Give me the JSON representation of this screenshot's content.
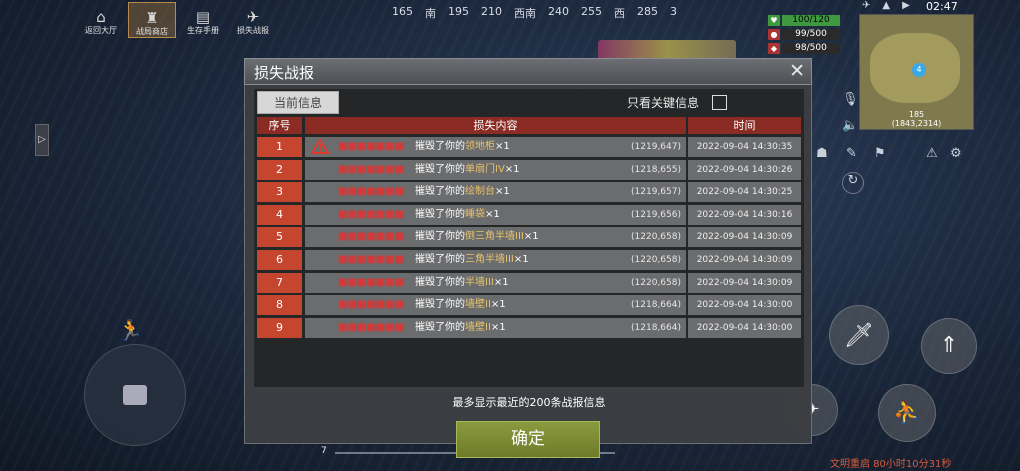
{
  "top_menu": [
    {
      "label": "返回大厅",
      "icon": "home-icon",
      "glyph": "⌂"
    },
    {
      "label": "战局商店",
      "icon": "shop-basket-icon",
      "glyph": "♜"
    },
    {
      "label": "生存手册",
      "icon": "book-icon",
      "glyph": "▤"
    },
    {
      "label": "损失战报",
      "icon": "broken-building-icon",
      "glyph": "✈"
    }
  ],
  "compass": [
    "165",
    "南",
    "195",
    "210",
    "西南",
    "240",
    "255",
    "西",
    "285",
    "3"
  ],
  "stats": [
    {
      "icon": "health-icon",
      "glyph": "♥",
      "value": "100/120",
      "color": "#3f9a3f"
    },
    {
      "icon": "food-icon",
      "glyph": "●",
      "value": "99/500",
      "color": "#a33"
    },
    {
      "icon": "water-icon",
      "glyph": "◆",
      "value": "98/500",
      "color": "#a33"
    }
  ],
  "clock": "02:47",
  "minimap": {
    "marker": "4",
    "coord_line1": "185",
    "coord_line2": "(1843,2314)"
  },
  "dialog": {
    "title": "损失战报",
    "close_glyph": "✕",
    "tab_current": "当前信息",
    "key_only_label": "只看关键信息",
    "key_only_checked": false,
    "columns": {
      "num": "序号",
      "content": "损失内容",
      "time": "时间"
    },
    "verb": "摧毁了你的",
    "rows": [
      {
        "num": "1",
        "player": "■■■■■■■",
        "item": "领地柜",
        "qty": "×1",
        "coord": "(1219,647)",
        "time": "2022-09-04 14:30:35",
        "warning": true
      },
      {
        "num": "2",
        "player": "■■■■■■■",
        "item": "单扇门IV",
        "qty": "×1",
        "coord": "(1218,655)",
        "time": "2022-09-04 14:30:26",
        "warning": false
      },
      {
        "num": "3",
        "player": "■■■■■■■",
        "item": "绘制台",
        "qty": "×1",
        "coord": "(1219,657)",
        "time": "2022-09-04 14:30:25",
        "warning": false
      },
      {
        "num": "4",
        "player": "■■■■■■■",
        "item": "睡袋",
        "qty": "×1",
        "coord": "(1219,656)",
        "time": "2022-09-04 14:30:16",
        "warning": false
      },
      {
        "num": "5",
        "player": "■■■■■■■",
        "item": "倒三角半墙III",
        "qty": "×1",
        "coord": "(1220,658)",
        "time": "2022-09-04 14:30:09",
        "warning": false
      },
      {
        "num": "6",
        "player": "■■■■■■■",
        "item": "三角半墙III",
        "qty": "×1",
        "coord": "(1220,658)",
        "time": "2022-09-04 14:30:09",
        "warning": false
      },
      {
        "num": "7",
        "player": "■■■■■■■",
        "item": "半墙III",
        "qty": "×1",
        "coord": "(1220,658)",
        "time": "2022-09-04 14:30:09",
        "warning": false
      },
      {
        "num": "8",
        "player": "■■■■■■■",
        "item": "墙壁II",
        "qty": "×1",
        "coord": "(1218,664)",
        "time": "2022-09-04 14:30:00",
        "warning": false
      },
      {
        "num": "9",
        "player": "■■■■■■■",
        "item": "墙壁II",
        "qty": "×1",
        "coord": "(1218,664)",
        "time": "2022-09-04 14:30:00",
        "warning": false
      }
    ],
    "footnote": "最多显示最近的200条战报信息",
    "ok_label": "确定"
  },
  "bottom": {
    "restart_text": "文明重启 80小时10分31秒",
    "hotbar_num": "7"
  },
  "colors": {
    "accent_red": "#c6452f",
    "header_red": "#8a2b24",
    "ok_green": "#7a8a33",
    "item_yellow": "#e8c36a"
  }
}
